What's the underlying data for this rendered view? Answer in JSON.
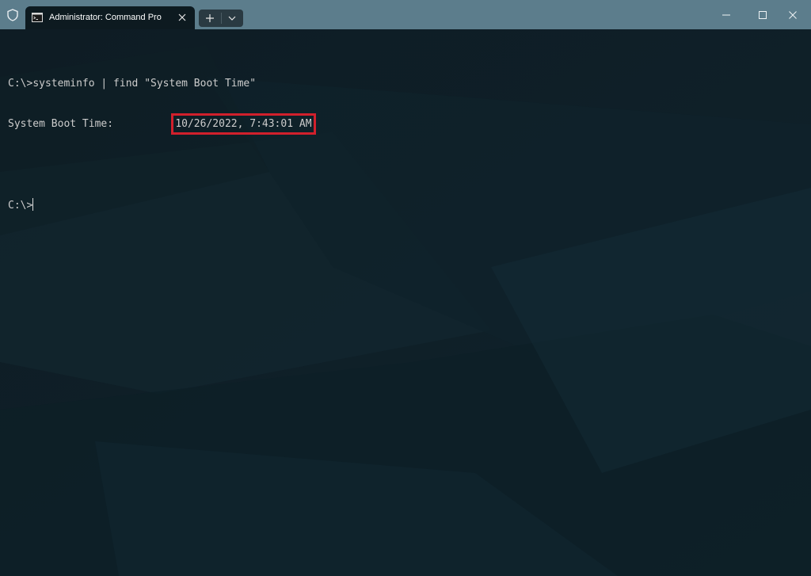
{
  "window": {
    "tab_title": "Administrator: Command Pro",
    "colors": {
      "titlebar": "#5c7d8c",
      "terminal_bg": "#0c1a21",
      "highlight": "#d1202c"
    }
  },
  "icons": {
    "shield": "shield-icon",
    "tab": "cmd-icon",
    "close_tab": "close-icon",
    "new_tab": "plus-icon",
    "dropdown": "chevron-down-icon",
    "minimize": "minimize-icon",
    "maximize": "maximize-icon",
    "close": "close-icon"
  },
  "terminal": {
    "prompt1": "C:\\>",
    "command": "systeminfo | find \"System Boot Time\"",
    "output_label": "System Boot Time:          ",
    "output_value": "10/26/2022, 7:43:01 AM",
    "prompt2": "C:\\>"
  }
}
